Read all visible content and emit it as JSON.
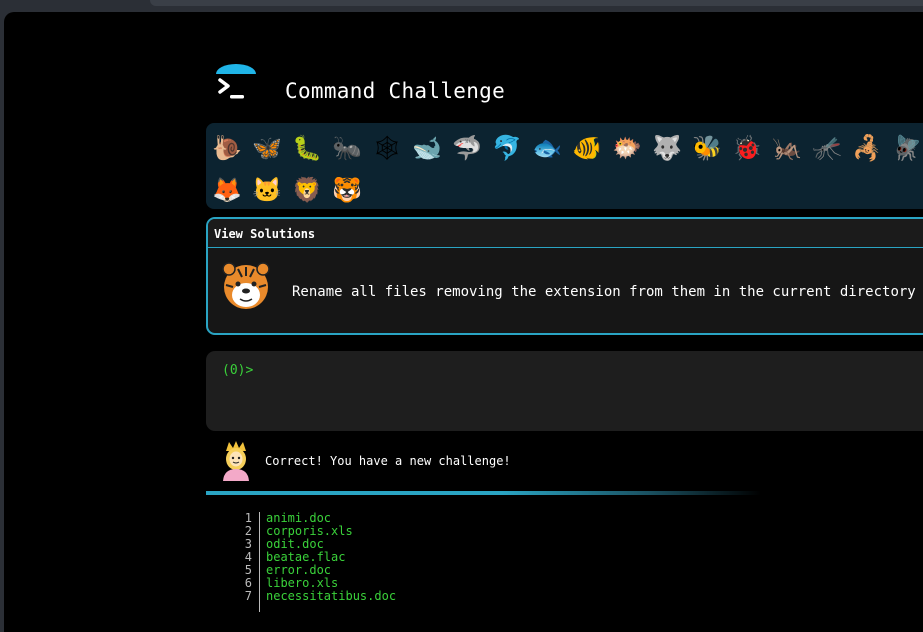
{
  "app": {
    "title": "Command Challenge",
    "close_glyph": "×",
    "accent": "#2aa4c3",
    "prompt_color": "#3ad13a"
  },
  "animals": [
    {
      "icon": "snail-icon",
      "glyph": "🐌"
    },
    {
      "icon": "butterfly-icon",
      "glyph": "🦋"
    },
    {
      "icon": "caterpillar-icon",
      "glyph": "🐛"
    },
    {
      "icon": "ant-icon",
      "glyph": "🐜"
    },
    {
      "icon": "spiderweb-icon",
      "glyph": "🕸"
    },
    {
      "icon": "whale-icon",
      "glyph": "🐋"
    },
    {
      "icon": "shark-icon",
      "glyph": "🦈"
    },
    {
      "icon": "dolphin-icon",
      "glyph": "🐬"
    },
    {
      "icon": "fish-icon",
      "glyph": "🐟"
    },
    {
      "icon": "tropical-fish-icon",
      "glyph": "🐠"
    },
    {
      "icon": "blowfish-icon",
      "glyph": "🐡"
    },
    {
      "icon": "wolf-icon",
      "glyph": "🐺"
    },
    {
      "icon": "bee-icon",
      "glyph": "🐝"
    },
    {
      "icon": "ladybug-icon",
      "glyph": "🐞"
    },
    {
      "icon": "cricket-icon",
      "glyph": "🦗"
    },
    {
      "icon": "mosquito-icon",
      "glyph": "🦟"
    },
    {
      "icon": "scorpion-icon",
      "glyph": "🦂"
    },
    {
      "icon": "fly-icon",
      "glyph": "🪰"
    },
    {
      "icon": "fox-icon",
      "glyph": "🦊"
    },
    {
      "icon": "cat-icon",
      "glyph": "🐱"
    },
    {
      "icon": "lion-icon",
      "glyph": "🦁"
    },
    {
      "icon": "tiger-icon",
      "glyph": "🐯"
    }
  ],
  "solutions": {
    "header": "View Solutions",
    "challenge_icon": "tiger-icon",
    "task": "Rename all files removing the extension from them in the current directory"
  },
  "terminal": {
    "prompt": "(0)>"
  },
  "status": {
    "icon": "princess-icon",
    "message": "Correct! You have a new challenge!"
  },
  "files": [
    {
      "num": "1",
      "name": "animi.doc"
    },
    {
      "num": "2",
      "name": "corporis.xls"
    },
    {
      "num": "3",
      "name": "odit.doc"
    },
    {
      "num": "4",
      "name": "beatae.flac"
    },
    {
      "num": "5",
      "name": "error.doc"
    },
    {
      "num": "6",
      "name": "libero.xls"
    },
    {
      "num": "7",
      "name": "necessitatibus.doc"
    }
  ]
}
